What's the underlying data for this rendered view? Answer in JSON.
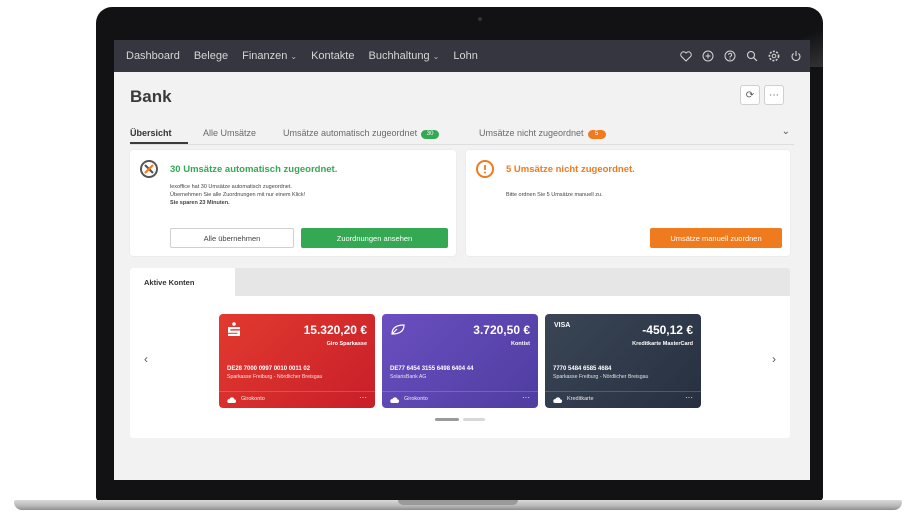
{
  "nav": {
    "items": [
      {
        "label": "Dashboard",
        "chevron": false
      },
      {
        "label": "Belege",
        "chevron": false
      },
      {
        "label": "Finanzen",
        "chevron": true
      },
      {
        "label": "Kontakte",
        "chevron": false
      },
      {
        "label": "Buchhaltung",
        "chevron": true
      },
      {
        "label": "Lohn",
        "chevron": false
      }
    ],
    "icons": [
      "heart-icon",
      "plus-circle-icon",
      "help-icon",
      "search-icon",
      "settings-icon",
      "power-icon"
    ]
  },
  "page": {
    "title": "Bank",
    "refresh_icon": "⟳",
    "more_icon": "⋯"
  },
  "tabs": {
    "items": [
      {
        "label": "Übersicht"
      },
      {
        "label": "Alle Umsätze"
      },
      {
        "label": "Umsätze automatisch zugeordnet",
        "badge": "30"
      },
      {
        "label": "Umsätze nicht zugeordnet",
        "badge": "5"
      }
    ],
    "expand_icon": "⌄"
  },
  "assigned_panel": {
    "heading": "30 Umsätze automatisch zugeordnet.",
    "line1": "lexoffice hat 30 Umsätze automatisch zugeordnet.",
    "line2": "Übernehmen Sie alle Zuordnungen mit nur einem Klick!",
    "line3": "Sie sparen 23 Minuten.",
    "btn_accept_all": "Alle übernehmen",
    "btn_view": "Zuordnungen ansehen"
  },
  "unassigned_panel": {
    "heading": "5 Umsätze nicht zugeordnet.",
    "text": "Bitte ordnen Sie 5 Umsätze manuell zu.",
    "btn_assign": "Umsätze manuell zuordnen"
  },
  "accounts": {
    "tab_label": "Aktive Konten",
    "prev": "‹",
    "next": "›",
    "cards": [
      {
        "balance": "15.320,20 €",
        "name": "Giro Sparkasse",
        "iban": "DE28 7000 0997 0010 0011 02",
        "bank": "Sparkasse Freiburg - Nördlicher Breisgau",
        "type": "Girokonto",
        "logo": "",
        "more": "···"
      },
      {
        "balance": "3.720,50 €",
        "name": "Kontist",
        "iban": "DE77 6454 3155 6498 6404 44",
        "bank": "SolarisBank AG",
        "type": "Girokonto",
        "logo": "",
        "more": "···"
      },
      {
        "balance": "-450,12 €",
        "name": "Kreditkarte MasterCard",
        "iban": "7770 5484 6585 4684",
        "bank": "Sparkasse Freiburg - Nördlicher Breisgau",
        "type": "Kreditkarte",
        "logo": "VISA",
        "more": "···"
      }
    ]
  },
  "colors": {
    "nav_bg": "#35363f",
    "green": "#34a853",
    "orange": "#f07a1e",
    "card_red": "#d7262b",
    "card_purple": "#5a45a8",
    "card_dark": "#2f3a4a"
  }
}
